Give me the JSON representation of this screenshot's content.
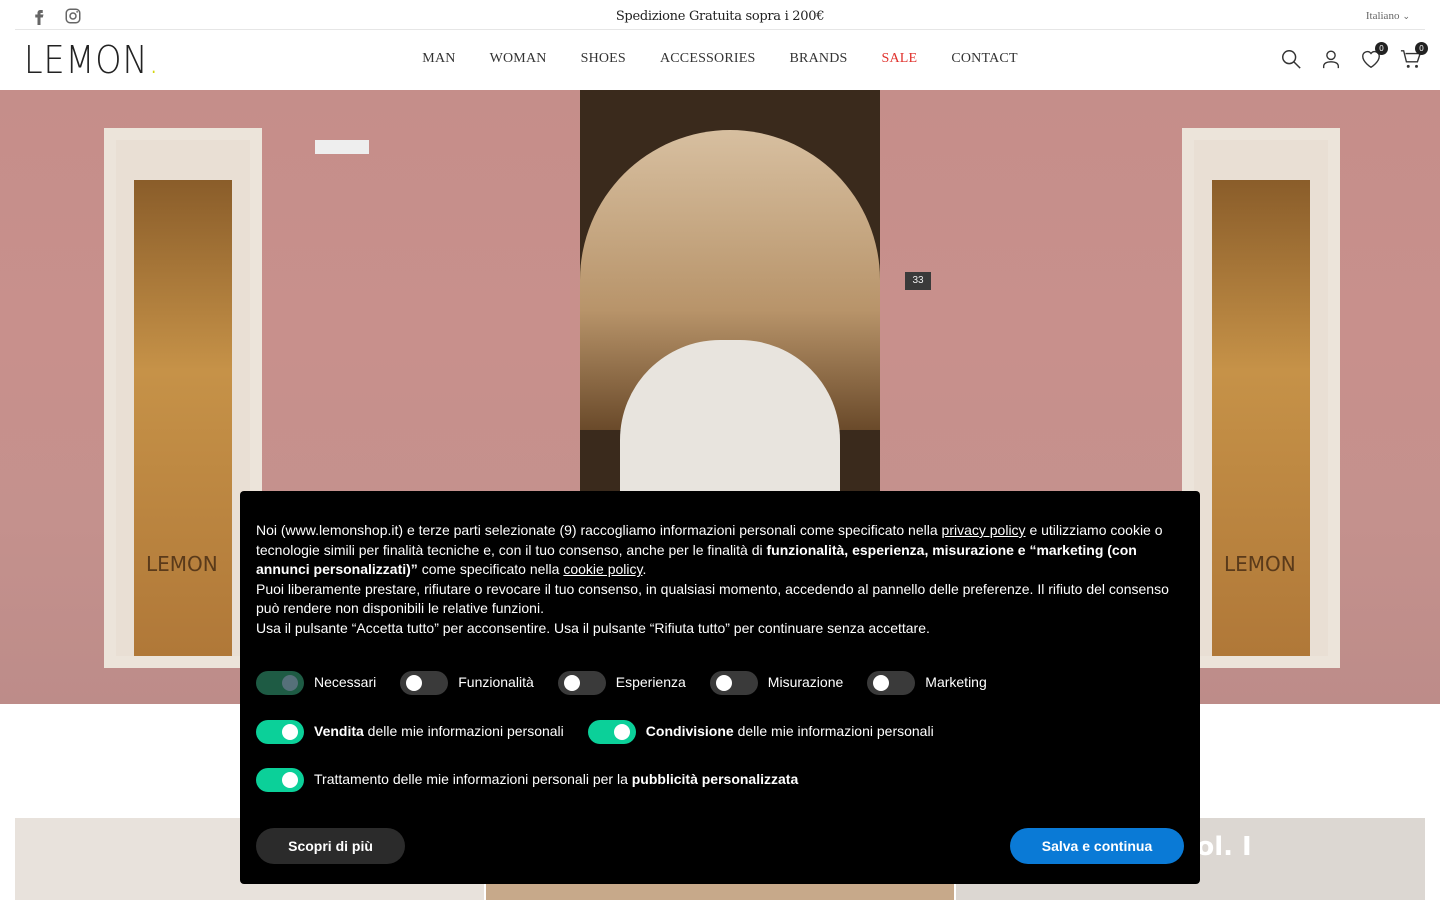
{
  "topbar": {
    "promo": "Spedizione Gratuita sopra i 200€",
    "language": "Italiano",
    "social": [
      "facebook-icon",
      "instagram-icon"
    ]
  },
  "header": {
    "logo_text": "LEMON",
    "logo_dot": ".",
    "nav": [
      {
        "label": "MAN"
      },
      {
        "label": "WOMAN"
      },
      {
        "label": "SHOES"
      },
      {
        "label": "ACCESSORIES"
      },
      {
        "label": "BRANDS"
      },
      {
        "label": "SALE"
      },
      {
        "label": "CONTACT"
      }
    ],
    "wishlist_count": "0",
    "cart_count": "0",
    "sale_color": "#e0302b",
    "logo_dot_color": "#d4d60f"
  },
  "hero": {
    "window_brand": "LEMON",
    "door_number": "33"
  },
  "tiles": {
    "t3_text": "ol. I"
  },
  "cookie": {
    "p1_a": "Noi (www.lemonshop.it) e terze parti selezionate (9) raccogliamo informazioni personali come specificato nella ",
    "privacy_link": "privacy policy",
    "p1_b": " e utilizziamo cookie o tecnologie simili per finalità tecniche e, con il tuo consenso, anche per le finalità di ",
    "p1_bold": "funzionalità, esperienza, misurazione e “marketing (con annunci personalizzati)”",
    "p1_c": " come specificato nella ",
    "cookie_link": "cookie policy",
    "p1_d": ".",
    "p2": "Puoi liberamente prestare, rifiutare o revocare il tuo consenso, in qualsiasi momento, accedendo al pannello delle preferenze. Il rifiuto del consenso può rendere non disponibili le relative funzioni.",
    "p3": "Usa il pulsante “Accetta tutto” per acconsentire. Usa il pulsante “Rifiuta tutto” per continuare senza accettare.",
    "toggles": [
      {
        "label": "Necessari",
        "state": "locked"
      },
      {
        "label": "Funzionalità",
        "state": "off"
      },
      {
        "label": "Esperienza",
        "state": "off"
      },
      {
        "label": "Misurazione",
        "state": "off"
      },
      {
        "label": "Marketing",
        "state": "off"
      }
    ],
    "sell_bold": "Vendita",
    "sell_rest": " delle mie informazioni personali",
    "share_bold": "Condivisione",
    "share_rest": " delle mie informazioni personali",
    "ads_rest": "Trattamento delle mie informazioni personali per la ",
    "ads_bold": "pubblicità personalizzata",
    "more_button": "Scopri di più",
    "save_button": "Salva e continua",
    "toggle_on_color": "#0bd099",
    "save_color": "#0a7ad6"
  }
}
